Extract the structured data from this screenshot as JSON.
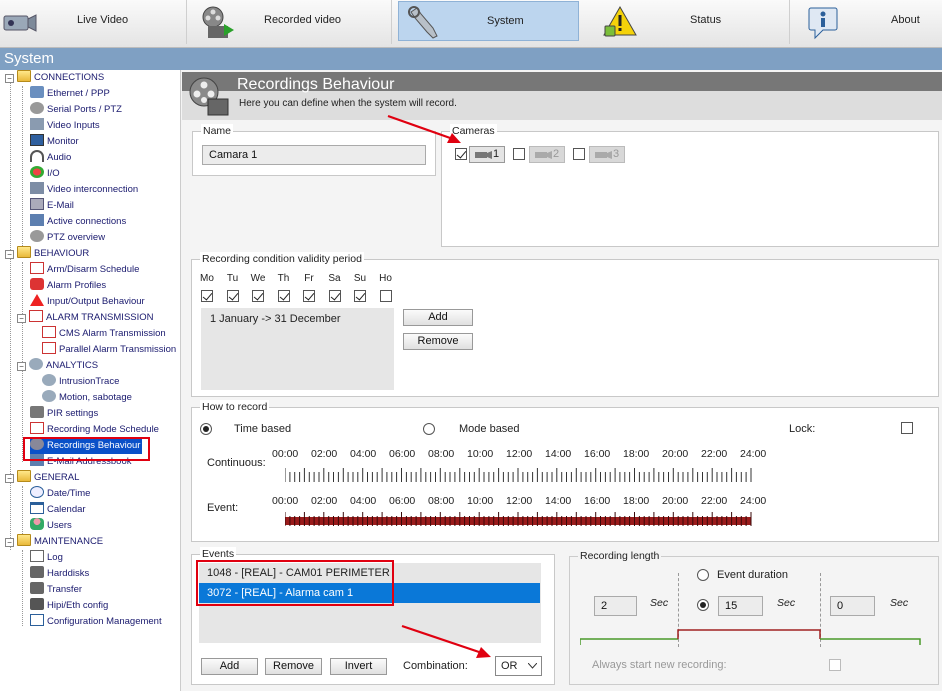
{
  "nav": {
    "items": [
      {
        "label": "Live Video",
        "icon": "camera-icon"
      },
      {
        "label": "Recorded video",
        "icon": "film-reel-icon"
      },
      {
        "label": "System",
        "icon": "wrench-icon"
      },
      {
        "label": "Status",
        "icon": "warning-icon"
      },
      {
        "label": "About",
        "icon": "info-icon"
      }
    ],
    "active": "System"
  },
  "section_title": "System",
  "sidebar": {
    "connections": "CONNECTIONS",
    "connections_items": [
      "Ethernet / PPP",
      "Serial Ports / PTZ",
      "Video Inputs",
      "Monitor",
      "Audio",
      "I/O",
      "Video interconnection",
      "E-Mail",
      "Active connections",
      "PTZ overview"
    ],
    "behaviour": "BEHAVIOUR",
    "behaviour_items": [
      "Arm/Disarm Schedule",
      "Alarm Profiles",
      "Input/Output Behaviour"
    ],
    "alarm_transmission": "ALARM TRANSMISSION",
    "alarm_items": [
      "CMS Alarm Transmission",
      "Parallel Alarm Transmission"
    ],
    "analytics": "ANALYTICS",
    "analytics_items": [
      "IntrusionTrace",
      "Motion, sabotage"
    ],
    "behaviour_items2": [
      "PIR settings",
      "Recording Mode Schedule",
      "Recordings Behaviour",
      "E-Mail Addressbook"
    ],
    "general": "GENERAL",
    "general_items": [
      "Date/Time",
      "Calendar",
      "Users"
    ],
    "maintenance": "MAINTENANCE",
    "maintenance_items": [
      "Log",
      "Harddisks",
      "Transfer",
      "Hipi/Eth config",
      "Configuration Management"
    ]
  },
  "header": {
    "title": "Recordings Behaviour",
    "subtitle": "Here you can define when the system will record."
  },
  "name_group": {
    "title": "Name",
    "value": "Camara 1"
  },
  "cameras_group": {
    "title": "Cameras",
    "cameras": [
      {
        "label": "1",
        "checked": true
      },
      {
        "label": "2",
        "checked": false
      },
      {
        "label": "3",
        "checked": false
      }
    ]
  },
  "validity": {
    "title": "Recording condition validity period",
    "days": [
      "Mo",
      "Tu",
      "We",
      "Th",
      "Fr",
      "Sa",
      "Su",
      "Ho"
    ],
    "days_checked": [
      true,
      true,
      true,
      true,
      true,
      true,
      true,
      false
    ],
    "periods": [
      "1 January -> 31 December"
    ],
    "add_label": "Add",
    "remove_label": "Remove"
  },
  "how_to_record": {
    "title": "How to record",
    "time_based": "Time based",
    "mode_based": "Mode based",
    "lock": "Lock:",
    "continuous": "Continuous:",
    "event": "Event:",
    "hours": [
      "00:00",
      "02:00",
      "04:00",
      "06:00",
      "08:00",
      "10:00",
      "12:00",
      "14:00",
      "16:00",
      "18:00",
      "20:00",
      "22:00",
      "24:00"
    ]
  },
  "events": {
    "title": "Events",
    "items": [
      "1048 - [REAL] -  CAM01 PERIMETER",
      "3072 - [REAL] -  Alarma cam 1"
    ],
    "selected_index": 1,
    "add_label": "Add",
    "remove_label": "Remove",
    "invert_label": "Invert",
    "combination_label": "Combination:",
    "combination_value": "OR"
  },
  "recording_length": {
    "title": "Recording length",
    "event_duration": "Event duration",
    "pre_value": "2",
    "duration_value": "15",
    "post_value": "0",
    "unit": "Sec",
    "always_new": "Always start new recording:"
  },
  "colors": {
    "accent_blue": "#0078d7",
    "timeline_red": "#9a1b1b",
    "highlight_red": "#e00010",
    "sysbar": "#7fa0c3"
  }
}
